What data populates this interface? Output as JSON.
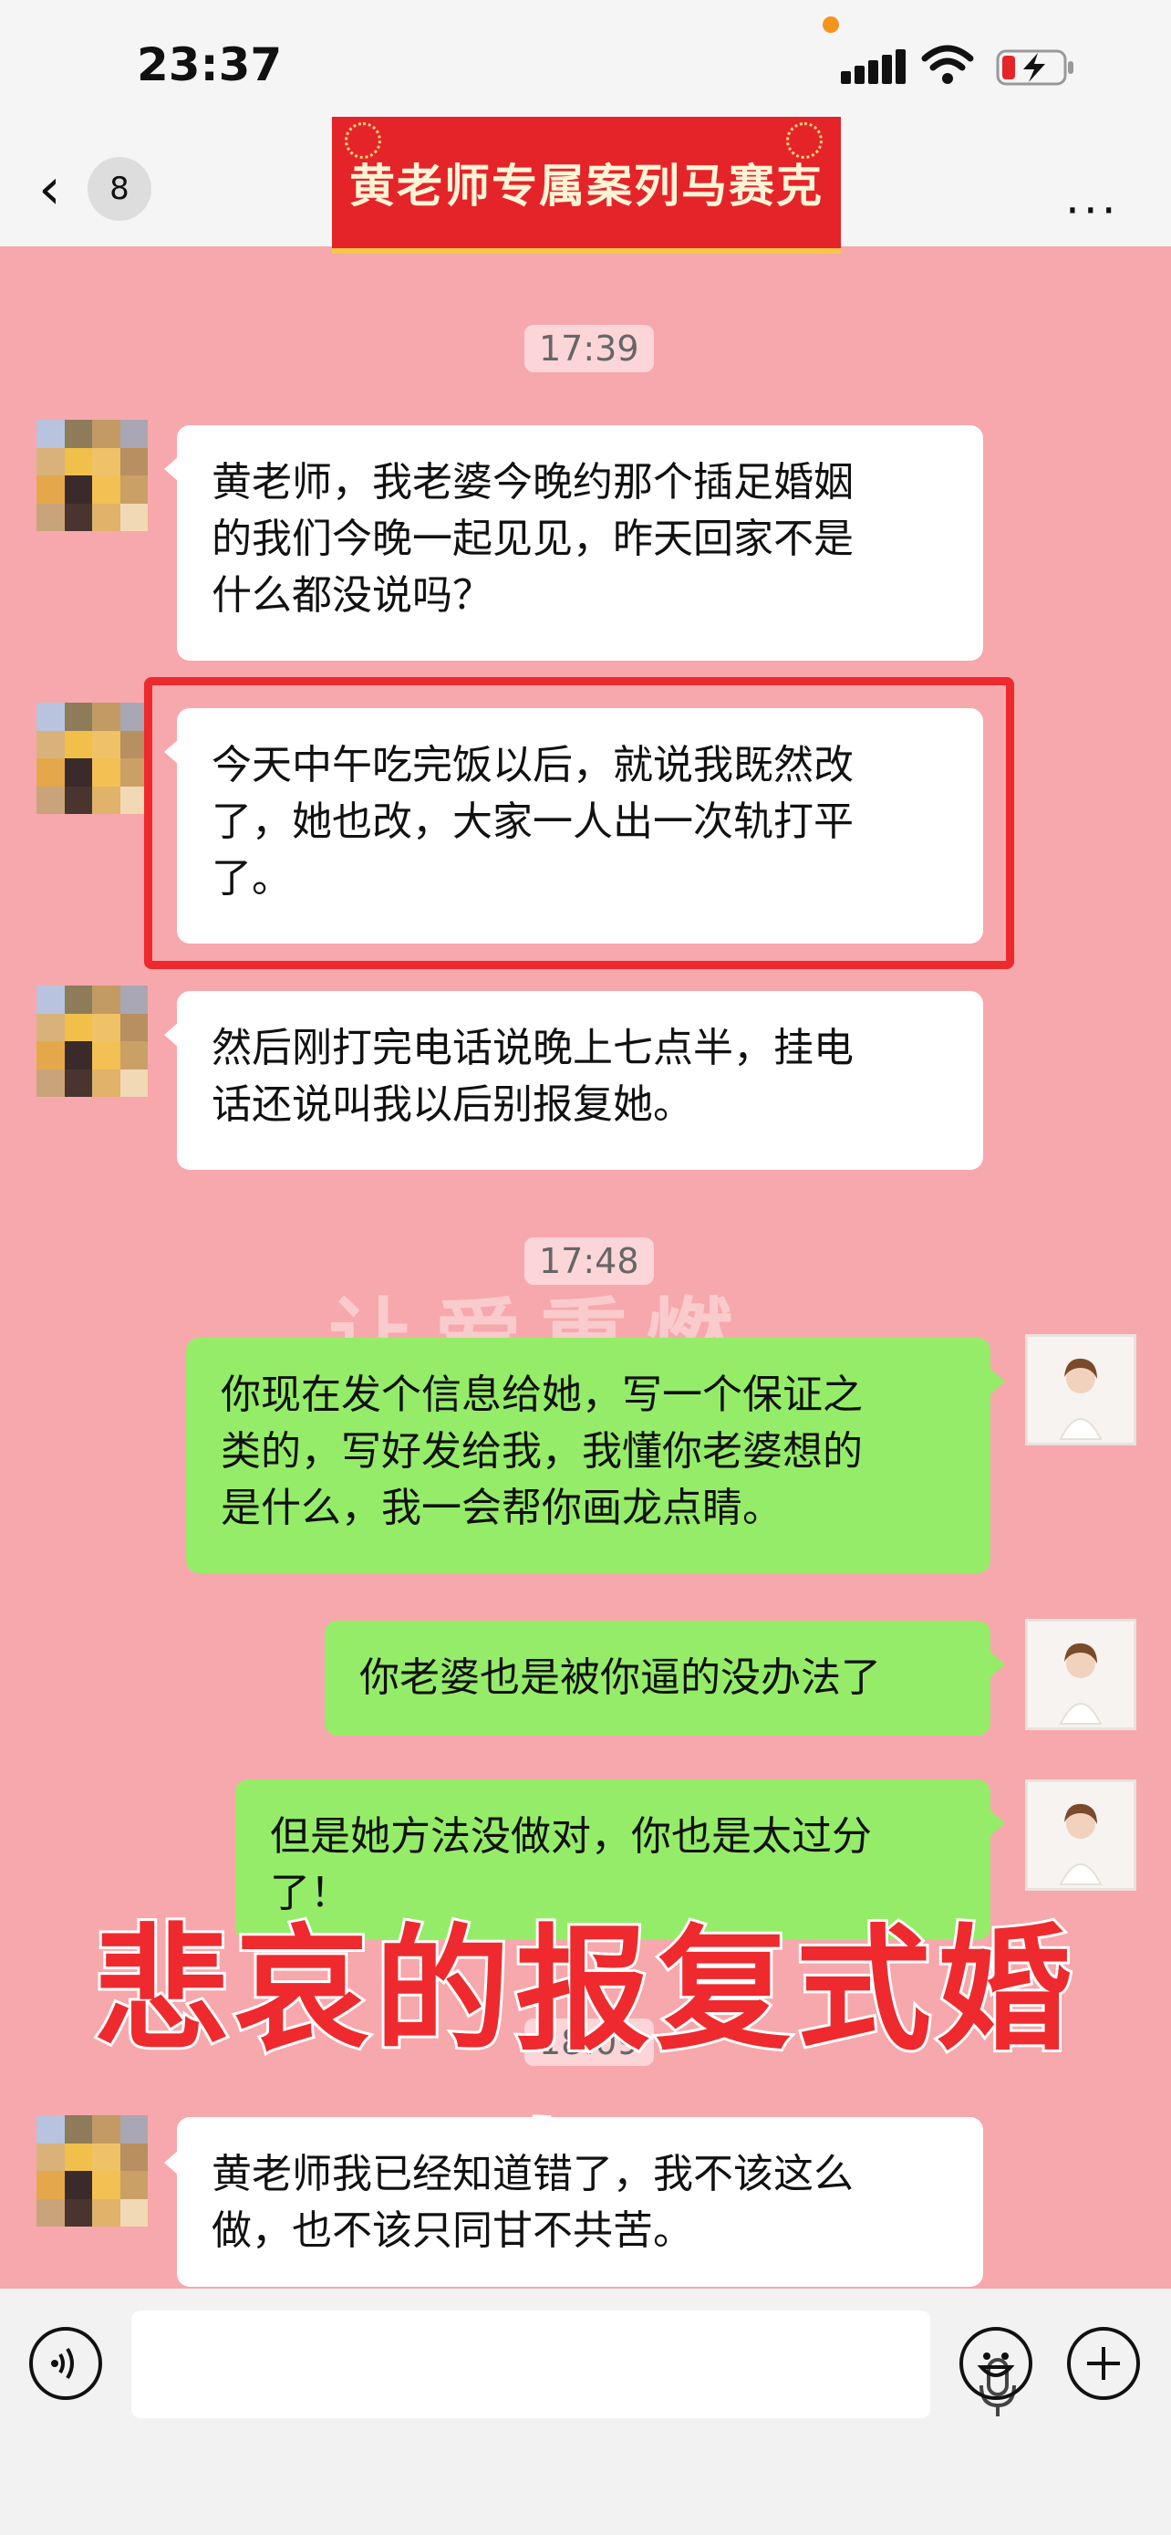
{
  "status_bar": {
    "time": "23:37"
  },
  "nav": {
    "back_count": "8",
    "banner_title": "黄老师专属案列马赛克",
    "more": "···"
  },
  "timestamps": [
    "17:39",
    "17:48",
    "18:09"
  ],
  "messages": [
    {
      "side": "left",
      "text": "黄老师，我老婆今晚约那个插足婚姻\n的我们今晚一起见见，昨天回家不是\n什么都没说吗？"
    },
    {
      "side": "left",
      "text": "今天中午吃完饭以后，就说我既然改\n了，她也改，大家一人出一次轨打平\n了。",
      "highlighted": true
    },
    {
      "side": "left",
      "text": "然后刚打完电话说晚上七点半，挂电\n话还说叫我以后别报复她。"
    },
    {
      "side": "right",
      "text": "你现在发个信息给她，写一个保证之\n类的，写好发给我，我懂你老婆想的\n是什么，我一会帮你画龙点睛。"
    },
    {
      "side": "right",
      "text": "你老婆也是被你逼的没办法了"
    },
    {
      "side": "right",
      "text": "但是她方法没做对，你也是太过分\n了！"
    },
    {
      "side": "left",
      "text": "黄老师我已经知道错了，我不该这么\n做，也不该只同甘不共苦。"
    }
  ],
  "watermark": "让爱重燃",
  "overlay_title": "悲哀的报复式婚姻",
  "colors": {
    "chat_bg": "#f7a8ac",
    "right_bubble": "#95ec69",
    "highlight": "#ee2a2e",
    "banner": "#e5242a"
  },
  "input_bar": {
    "voice_icon": "voice-toggle-icon",
    "mic_icon": "microphone-icon",
    "emoji_icon": "emoji-icon",
    "plus_icon": "plus-icon"
  }
}
